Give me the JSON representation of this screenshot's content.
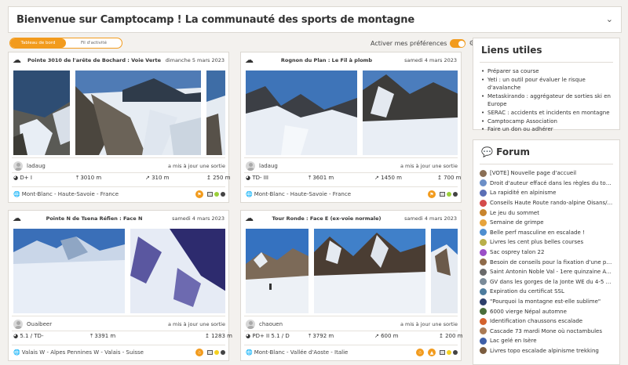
{
  "header": {
    "title": "Bienvenue sur Camptocamp ! La communauté des sports de montagne",
    "chevron_icon": "chevron-down-icon"
  },
  "tabs": [
    {
      "label": "Tableau de bord",
      "active": true
    },
    {
      "label": "Fil d'activité",
      "active": false
    }
  ],
  "preferences": {
    "label": "Activer mes préférences",
    "enabled": true
  },
  "cards": [
    {
      "title": "Pointe 3010 de l'arête de Bochard : Voie Verte",
      "date": "dimanche 5 mars 2023",
      "user": "ladaug",
      "action": "a mis à jour une sortie",
      "rating": "D+ I",
      "elevation_max": "3010 m",
      "gain": "310 m",
      "height": "250 m",
      "location": "Mont-Blanc - Haute-Savoie - France"
    },
    {
      "title": "Rognon du Plan : Le Fil à plomb",
      "date": "samedi 4 mars 2023",
      "user": "ladaug",
      "action": "a mis à jour une sortie",
      "rating": "TD- III",
      "elevation_max": "3601 m",
      "gain": "1450 m",
      "height": "700 m",
      "location": "Mont-Blanc - Haute-Savoie - France"
    },
    {
      "title": "Pointe N de Tsena Réfien : Face N",
      "date": "samedi 4 mars 2023",
      "user": "Ouaibeer",
      "action": "a mis à jour une sortie",
      "rating": "5.1 / TD-",
      "elevation_max": "3391 m",
      "gain": "",
      "height": "1283 m",
      "location": "Valais W - Alpes Pennines W - Valais - Suisse"
    },
    {
      "title": "Tour Ronde : Face E (ex-voie normale)",
      "date": "samedi 4 mars 2023",
      "user": "chaouen",
      "action": "a mis à jour une sortie",
      "rating": "PD+ II 5.1 / D",
      "elevation_max": "3792 m",
      "gain": "600 m",
      "height": "200 m",
      "location": "Mont-Blanc - Vallée d'Aoste - Italie"
    }
  ],
  "useful_links": {
    "title": "Liens utiles",
    "items": [
      "Préparer sa course",
      "Yeti : un outil pour évaluer le risque d'avalanche",
      "Metaskirando : aggrégateur de sorties ski en Europe",
      "SERAC : accidents et incidents en montagne",
      "Camptocamp Association",
      "Faire un don ou adhérer"
    ]
  },
  "forum": {
    "title": "Forum",
    "items": [
      {
        "text": "[VOTE] Nouvelle page d'accueil",
        "color": "#8a6f55"
      },
      {
        "text": "Droit d'auteur effacé dans les règles du top...",
        "color": "#6c8fc7"
      },
      {
        "text": "La rapidité en alpinisme",
        "color": "#5b6fb5"
      },
      {
        "text": "Conseils Haute Route rando-alpine Oisans/...",
        "color": "#d44b4b"
      },
      {
        "text": "Le jeu du sommet",
        "color": "#c8842d"
      },
      {
        "text": "Semaine de grimpe",
        "color": "#e7a43c"
      },
      {
        "text": "Belle perf masculine en escalade !",
        "color": "#4f8fd0"
      },
      {
        "text": "Livres les cent plus belles courses",
        "color": "#b9b04a"
      },
      {
        "text": "Sac osprey talon 22",
        "color": "#9b4fc7"
      },
      {
        "text": "Besoin de conseils pour la fixation d'une po...",
        "color": "#8f6b4a"
      },
      {
        "text": "Saint Antonin Noble Val - 1ere quinzaine Av...",
        "color": "#6a6a6a"
      },
      {
        "text": "GV dans les gorges de la Jonte WE du 4-5 m...",
        "color": "#7a8b99"
      },
      {
        "text": "Expiration du certificat SSL",
        "color": "#4d7c9e"
      },
      {
        "text": "\"Pourquoi la montagne est-elle sublime\"",
        "color": "#2d3f6b"
      },
      {
        "text": "6000 vierge Népal automne",
        "color": "#4a6e3a"
      },
      {
        "text": "Identification chaussons escalade",
        "color": "#d4622d"
      },
      {
        "text": "Cascade 73 mardi Mone où noctambules",
        "color": "#aa7b55"
      },
      {
        "text": "Lac gelé en Isère",
        "color": "#3e5fa8"
      },
      {
        "text": "Livres topo escalade alpinisme trekking",
        "color": "#7b5c3f"
      }
    ]
  }
}
